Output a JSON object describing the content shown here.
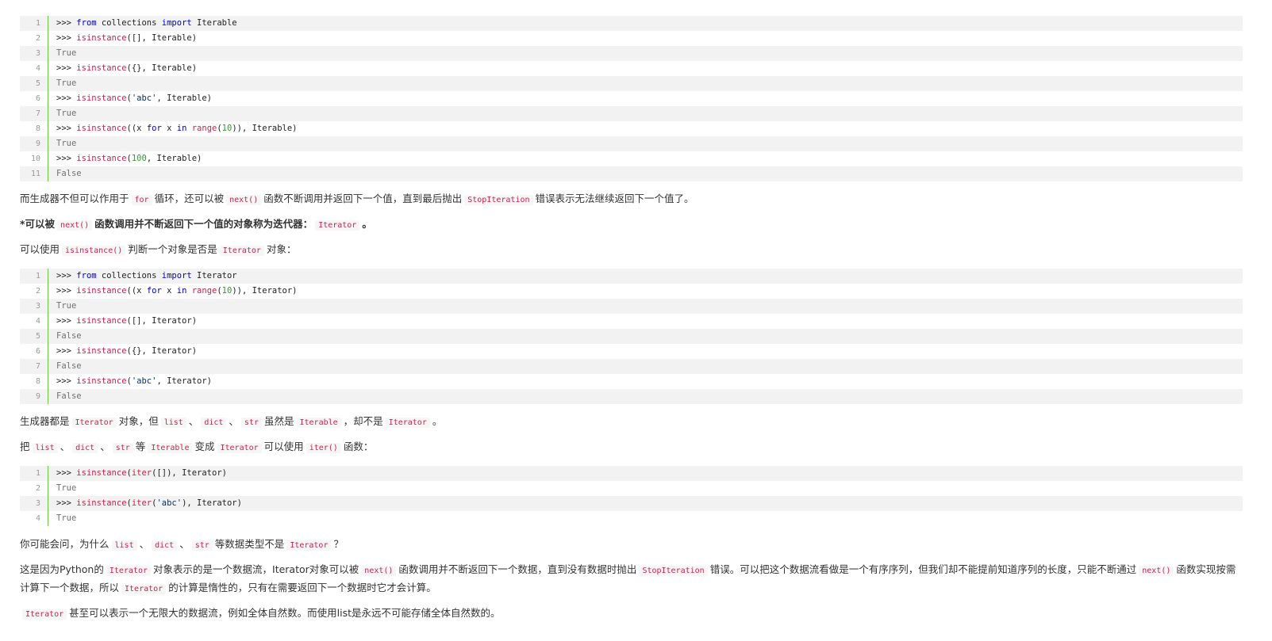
{
  "code_block_1": {
    "lines": [
      {
        "n": "1",
        "segs": [
          {
            "t": ">>> ",
            "c": ""
          },
          {
            "t": "from",
            "c": "kw"
          },
          {
            "t": " collections ",
            "c": ""
          },
          {
            "t": "import",
            "c": "kw"
          },
          {
            "t": " Iterable",
            "c": ""
          }
        ]
      },
      {
        "n": "2",
        "segs": [
          {
            "t": ">>> ",
            "c": ""
          },
          {
            "t": "isinstance",
            "c": "fn"
          },
          {
            "t": "([], Iterable)",
            "c": ""
          }
        ]
      },
      {
        "n": "3",
        "segs": [
          {
            "t": "True",
            "c": "out"
          }
        ]
      },
      {
        "n": "4",
        "segs": [
          {
            "t": ">>> ",
            "c": ""
          },
          {
            "t": "isinstance",
            "c": "fn"
          },
          {
            "t": "({}, Iterable)",
            "c": ""
          }
        ]
      },
      {
        "n": "5",
        "segs": [
          {
            "t": "True",
            "c": "out"
          }
        ]
      },
      {
        "n": "6",
        "segs": [
          {
            "t": ">>> ",
            "c": ""
          },
          {
            "t": "isinstance",
            "c": "fn"
          },
          {
            "t": "(",
            "c": ""
          },
          {
            "t": "'abc'",
            "c": "str"
          },
          {
            "t": ", Iterable)",
            "c": ""
          }
        ]
      },
      {
        "n": "7",
        "segs": [
          {
            "t": "True",
            "c": "out"
          }
        ]
      },
      {
        "n": "8",
        "segs": [
          {
            "t": ">>> ",
            "c": ""
          },
          {
            "t": "isinstance",
            "c": "fn"
          },
          {
            "t": "((x ",
            "c": ""
          },
          {
            "t": "for",
            "c": "kw"
          },
          {
            "t": " x ",
            "c": ""
          },
          {
            "t": "in",
            "c": "kw"
          },
          {
            "t": " ",
            "c": ""
          },
          {
            "t": "range",
            "c": "fn"
          },
          {
            "t": "(",
            "c": ""
          },
          {
            "t": "10",
            "c": "num"
          },
          {
            "t": ")), Iterable)",
            "c": ""
          }
        ]
      },
      {
        "n": "9",
        "segs": [
          {
            "t": "True",
            "c": "out"
          }
        ]
      },
      {
        "n": "10",
        "segs": [
          {
            "t": ">>> ",
            "c": ""
          },
          {
            "t": "isinstance",
            "c": "fn"
          },
          {
            "t": "(",
            "c": ""
          },
          {
            "t": "100",
            "c": "num"
          },
          {
            "t": ", Iterable)",
            "c": ""
          }
        ]
      },
      {
        "n": "11",
        "segs": [
          {
            "t": "False",
            "c": "out"
          }
        ]
      }
    ]
  },
  "para_1": [
    {
      "t": "而生成器不但可以作用于",
      "c": ""
    },
    {
      "t": "for",
      "c": "ic"
    },
    {
      "t": "循环，还可以被",
      "c": ""
    },
    {
      "t": "next()",
      "c": "ic"
    },
    {
      "t": "函数不断调用并返回下一个值，直到最后抛出",
      "c": ""
    },
    {
      "t": "StopIteration",
      "c": "ic"
    },
    {
      "t": "错误表示无法继续返回下一个值了。",
      "c": ""
    }
  ],
  "para_2": [
    {
      "t": "*可以被",
      "c": ""
    },
    {
      "t": "next()",
      "c": "ic"
    },
    {
      "t": "函数调用并不断返回下一个值的对象称为迭代器：",
      "c": ""
    },
    {
      "t": "Iterator",
      "c": "ic"
    },
    {
      "t": "。",
      "c": ""
    }
  ],
  "para_3": [
    {
      "t": "可以使用",
      "c": ""
    },
    {
      "t": "isinstance()",
      "c": "ic"
    },
    {
      "t": "判断一个对象是否是",
      "c": ""
    },
    {
      "t": "Iterator",
      "c": "ic"
    },
    {
      "t": "对象：",
      "c": ""
    }
  ],
  "code_block_2": {
    "lines": [
      {
        "n": "1",
        "segs": [
          {
            "t": ">>> ",
            "c": ""
          },
          {
            "t": "from",
            "c": "kw"
          },
          {
            "t": " collections ",
            "c": ""
          },
          {
            "t": "import",
            "c": "kw"
          },
          {
            "t": " Iterator",
            "c": ""
          }
        ]
      },
      {
        "n": "2",
        "segs": [
          {
            "t": ">>> ",
            "c": ""
          },
          {
            "t": "isinstance",
            "c": "fn"
          },
          {
            "t": "((x ",
            "c": ""
          },
          {
            "t": "for",
            "c": "kw"
          },
          {
            "t": " x ",
            "c": ""
          },
          {
            "t": "in",
            "c": "kw"
          },
          {
            "t": " ",
            "c": ""
          },
          {
            "t": "range",
            "c": "fn"
          },
          {
            "t": "(",
            "c": ""
          },
          {
            "t": "10",
            "c": "num"
          },
          {
            "t": ")), Iterator)",
            "c": ""
          }
        ]
      },
      {
        "n": "3",
        "segs": [
          {
            "t": "True",
            "c": "out"
          }
        ]
      },
      {
        "n": "4",
        "segs": [
          {
            "t": ">>> ",
            "c": ""
          },
          {
            "t": "isinstance",
            "c": "fn"
          },
          {
            "t": "([], Iterator)",
            "c": ""
          }
        ]
      },
      {
        "n": "5",
        "segs": [
          {
            "t": "False",
            "c": "out"
          }
        ]
      },
      {
        "n": "6",
        "segs": [
          {
            "t": ">>> ",
            "c": ""
          },
          {
            "t": "isinstance",
            "c": "fn"
          },
          {
            "t": "({}, Iterator)",
            "c": ""
          }
        ]
      },
      {
        "n": "7",
        "segs": [
          {
            "t": "False",
            "c": "out"
          }
        ]
      },
      {
        "n": "8",
        "segs": [
          {
            "t": ">>> ",
            "c": ""
          },
          {
            "t": "isinstance",
            "c": "fn"
          },
          {
            "t": "(",
            "c": ""
          },
          {
            "t": "'abc'",
            "c": "str"
          },
          {
            "t": ", Iterator)",
            "c": ""
          }
        ]
      },
      {
        "n": "9",
        "segs": [
          {
            "t": "False",
            "c": "out"
          }
        ]
      }
    ]
  },
  "para_4": [
    {
      "t": "生成器都是",
      "c": ""
    },
    {
      "t": "Iterator",
      "c": "ic"
    },
    {
      "t": "对象，但",
      "c": ""
    },
    {
      "t": "list",
      "c": "ic"
    },
    {
      "t": "、",
      "c": ""
    },
    {
      "t": "dict",
      "c": "ic"
    },
    {
      "t": "、",
      "c": ""
    },
    {
      "t": "str",
      "c": "ic"
    },
    {
      "t": "虽然是",
      "c": ""
    },
    {
      "t": "Iterable",
      "c": "ic"
    },
    {
      "t": "，却不是",
      "c": ""
    },
    {
      "t": "Iterator",
      "c": "ic"
    },
    {
      "t": "。",
      "c": ""
    }
  ],
  "para_5": [
    {
      "t": "把",
      "c": ""
    },
    {
      "t": "list",
      "c": "ic"
    },
    {
      "t": "、",
      "c": ""
    },
    {
      "t": "dict",
      "c": "ic"
    },
    {
      "t": "、",
      "c": ""
    },
    {
      "t": "str",
      "c": "ic"
    },
    {
      "t": "等",
      "c": ""
    },
    {
      "t": "Iterable",
      "c": "ic"
    },
    {
      "t": "变成",
      "c": ""
    },
    {
      "t": "Iterator",
      "c": "ic"
    },
    {
      "t": "可以使用",
      "c": ""
    },
    {
      "t": "iter()",
      "c": "ic"
    },
    {
      "t": "函数：",
      "c": ""
    }
  ],
  "code_block_3": {
    "lines": [
      {
        "n": "1",
        "segs": [
          {
            "t": ">>> ",
            "c": ""
          },
          {
            "t": "isinstance",
            "c": "fn"
          },
          {
            "t": "(",
            "c": ""
          },
          {
            "t": "iter",
            "c": "fn"
          },
          {
            "t": "([]), Iterator)",
            "c": ""
          }
        ]
      },
      {
        "n": "2",
        "segs": [
          {
            "t": "True",
            "c": "out"
          }
        ]
      },
      {
        "n": "3",
        "segs": [
          {
            "t": ">>> ",
            "c": ""
          },
          {
            "t": "isinstance",
            "c": "fn"
          },
          {
            "t": "(",
            "c": ""
          },
          {
            "t": "iter",
            "c": "fn"
          },
          {
            "t": "(",
            "c": ""
          },
          {
            "t": "'abc'",
            "c": "str"
          },
          {
            "t": "), Iterator)",
            "c": ""
          }
        ]
      },
      {
        "n": "4",
        "segs": [
          {
            "t": "True",
            "c": "out"
          }
        ]
      }
    ]
  },
  "para_6": [
    {
      "t": "你可能会问，为什么",
      "c": ""
    },
    {
      "t": "list",
      "c": "ic"
    },
    {
      "t": "、",
      "c": ""
    },
    {
      "t": "dict",
      "c": "ic"
    },
    {
      "t": "、",
      "c": ""
    },
    {
      "t": "str",
      "c": "ic"
    },
    {
      "t": "等数据类型不是",
      "c": ""
    },
    {
      "t": "Iterator",
      "c": "ic"
    },
    {
      "t": "？",
      "c": ""
    }
  ],
  "para_7": [
    {
      "t": "这是因为Python的",
      "c": ""
    },
    {
      "t": "Iterator",
      "c": "ic"
    },
    {
      "t": "对象表示的是一个数据流，Iterator对象可以被",
      "c": ""
    },
    {
      "t": "next()",
      "c": "ic"
    },
    {
      "t": "函数调用并不断返回下一个数据，直到没有数据时抛出",
      "c": ""
    },
    {
      "t": "StopIteration",
      "c": "ic"
    },
    {
      "t": "错误。可以把这个数据流看做是一个有序序列，但我们却不能提前知道序列的长度，只能不断通过",
      "c": ""
    },
    {
      "t": "next()",
      "c": "ic"
    },
    {
      "t": "函数实现按需计算下一个数据，所以",
      "c": ""
    },
    {
      "t": "Iterator",
      "c": "ic"
    },
    {
      "t": "的计算是惰性的，只有在需要返回下一个数据时它才会计算。",
      "c": ""
    }
  ],
  "para_8": [
    {
      "t": "Iterator",
      "c": "ic"
    },
    {
      "t": "甚至可以表示一个无限大的数据流，例如全体自然数。而使用list是永远不可能存储全体自然数的。",
      "c": ""
    }
  ]
}
